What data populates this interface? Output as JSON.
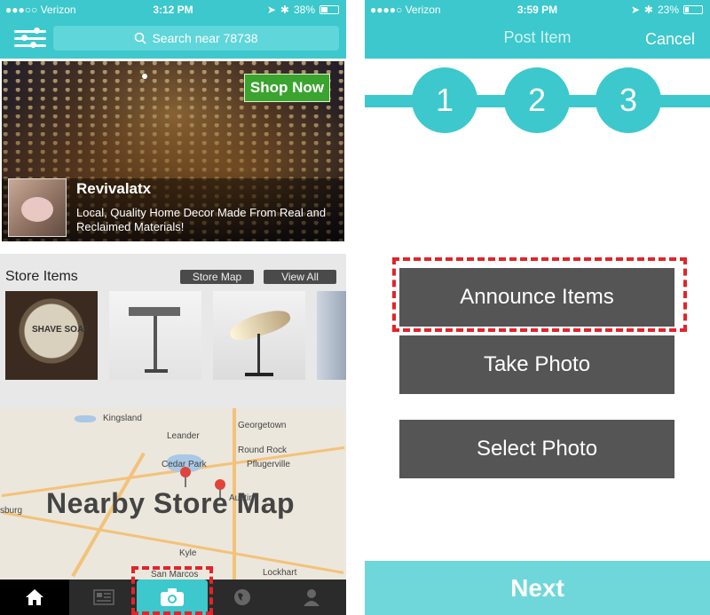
{
  "left": {
    "status": {
      "carrier": "●●●○○ Verizon",
      "time": "3:12 PM",
      "battery": "38%",
      "battery_level": 0.38
    },
    "search_placeholder": "Search near 78738",
    "banner": {
      "cta": "Shop Now",
      "store_name": "Revivalatx",
      "description": "Local, Quality Home Decor Made From Real and Reclaimed Materials!"
    },
    "items": {
      "title": "Store Items",
      "store_map_label": "Store Map",
      "view_all_label": "View All",
      "thumbs": [
        {
          "caption": "SHAVE SOAP"
        },
        {
          "caption": ""
        },
        {
          "caption": ""
        },
        {
          "caption": ""
        }
      ]
    },
    "map": {
      "title": "Nearby Store Map",
      "labels": [
        "Kingsland",
        "Leander",
        "Georgetown",
        "Round Rock",
        "Cedar Park",
        "Pflugerville",
        "sburg",
        "Austin",
        "Kyle",
        "San Marcos",
        "Lockhart"
      ]
    },
    "nav": [
      "home-icon",
      "catalog-icon",
      "camera-icon",
      "globe-icon",
      "profile-icon"
    ]
  },
  "right": {
    "status": {
      "carrier": "●●●●○ Verizon",
      "time": "3:59 PM",
      "battery": "23%",
      "battery_level": 0.23
    },
    "title": "Post Item",
    "cancel": "Cancel",
    "steps": [
      "1",
      "2",
      "3"
    ],
    "buttons": {
      "announce": "Announce Items",
      "take_photo": "Take Photo",
      "select_photo": "Select Photo"
    },
    "next": "Next"
  },
  "colors": {
    "accent": "#3cc8cc",
    "button": "#555555",
    "highlight": "#e2242a",
    "cta": "#3aa42e"
  }
}
